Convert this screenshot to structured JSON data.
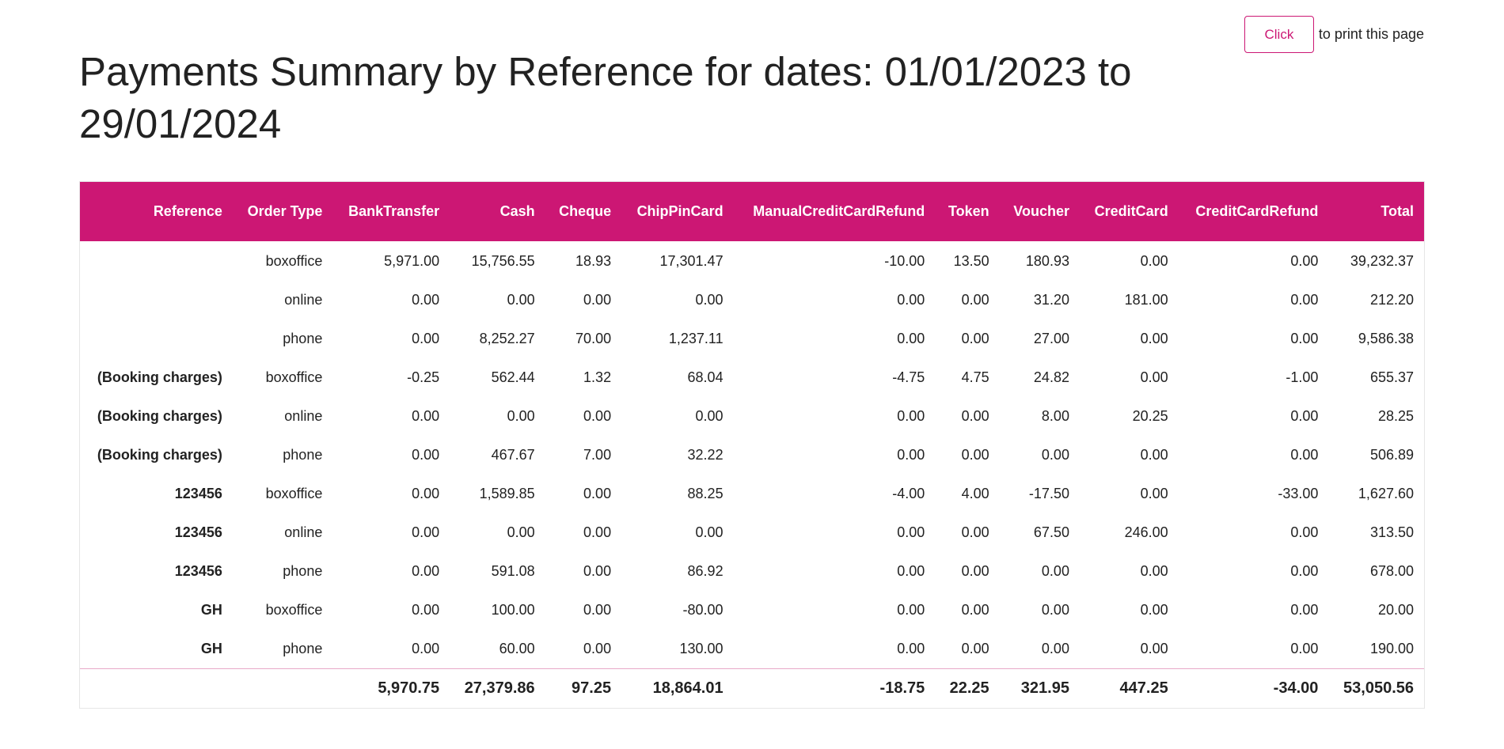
{
  "print": {
    "button_label": "Click",
    "suffix": "to print this page"
  },
  "title": "Payments Summary by Reference for dates: 01/01/2023 to 29/01/2024",
  "colors": {
    "accent": "#cc1774",
    "header_text": "#ffffff"
  },
  "table": {
    "columns": [
      "Reference",
      "Order Type",
      "BankTransfer",
      "Cash",
      "Cheque",
      "ChipPinCard",
      "ManualCreditCardRefund",
      "Token",
      "Voucher",
      "CreditCard",
      "CreditCardRefund",
      "Total"
    ],
    "rows": [
      [
        "",
        "boxoffice",
        "5,971.00",
        "15,756.55",
        "18.93",
        "17,301.47",
        "-10.00",
        "13.50",
        "180.93",
        "0.00",
        "0.00",
        "39,232.37"
      ],
      [
        "",
        "online",
        "0.00",
        "0.00",
        "0.00",
        "0.00",
        "0.00",
        "0.00",
        "31.20",
        "181.00",
        "0.00",
        "212.20"
      ],
      [
        "",
        "phone",
        "0.00",
        "8,252.27",
        "70.00",
        "1,237.11",
        "0.00",
        "0.00",
        "27.00",
        "0.00",
        "0.00",
        "9,586.38"
      ],
      [
        "(Booking charges)",
        "boxoffice",
        "-0.25",
        "562.44",
        "1.32",
        "68.04",
        "-4.75",
        "4.75",
        "24.82",
        "0.00",
        "-1.00",
        "655.37"
      ],
      [
        "(Booking charges)",
        "online",
        "0.00",
        "0.00",
        "0.00",
        "0.00",
        "0.00",
        "0.00",
        "8.00",
        "20.25",
        "0.00",
        "28.25"
      ],
      [
        "(Booking charges)",
        "phone",
        "0.00",
        "467.67",
        "7.00",
        "32.22",
        "0.00",
        "0.00",
        "0.00",
        "0.00",
        "0.00",
        "506.89"
      ],
      [
        "123456",
        "boxoffice",
        "0.00",
        "1,589.85",
        "0.00",
        "88.25",
        "-4.00",
        "4.00",
        "-17.50",
        "0.00",
        "-33.00",
        "1,627.60"
      ],
      [
        "123456",
        "online",
        "0.00",
        "0.00",
        "0.00",
        "0.00",
        "0.00",
        "0.00",
        "67.50",
        "246.00",
        "0.00",
        "313.50"
      ],
      [
        "123456",
        "phone",
        "0.00",
        "591.08",
        "0.00",
        "86.92",
        "0.00",
        "0.00",
        "0.00",
        "0.00",
        "0.00",
        "678.00"
      ],
      [
        "GH",
        "boxoffice",
        "0.00",
        "100.00",
        "0.00",
        "-80.00",
        "0.00",
        "0.00",
        "0.00",
        "0.00",
        "0.00",
        "20.00"
      ],
      [
        "GH",
        "phone",
        "0.00",
        "60.00",
        "0.00",
        "130.00",
        "0.00",
        "0.00",
        "0.00",
        "0.00",
        "0.00",
        "190.00"
      ]
    ],
    "totals": [
      "",
      "",
      "5,970.75",
      "27,379.86",
      "97.25",
      "18,864.01",
      "-18.75",
      "22.25",
      "321.95",
      "447.25",
      "-34.00",
      "53,050.56"
    ]
  }
}
